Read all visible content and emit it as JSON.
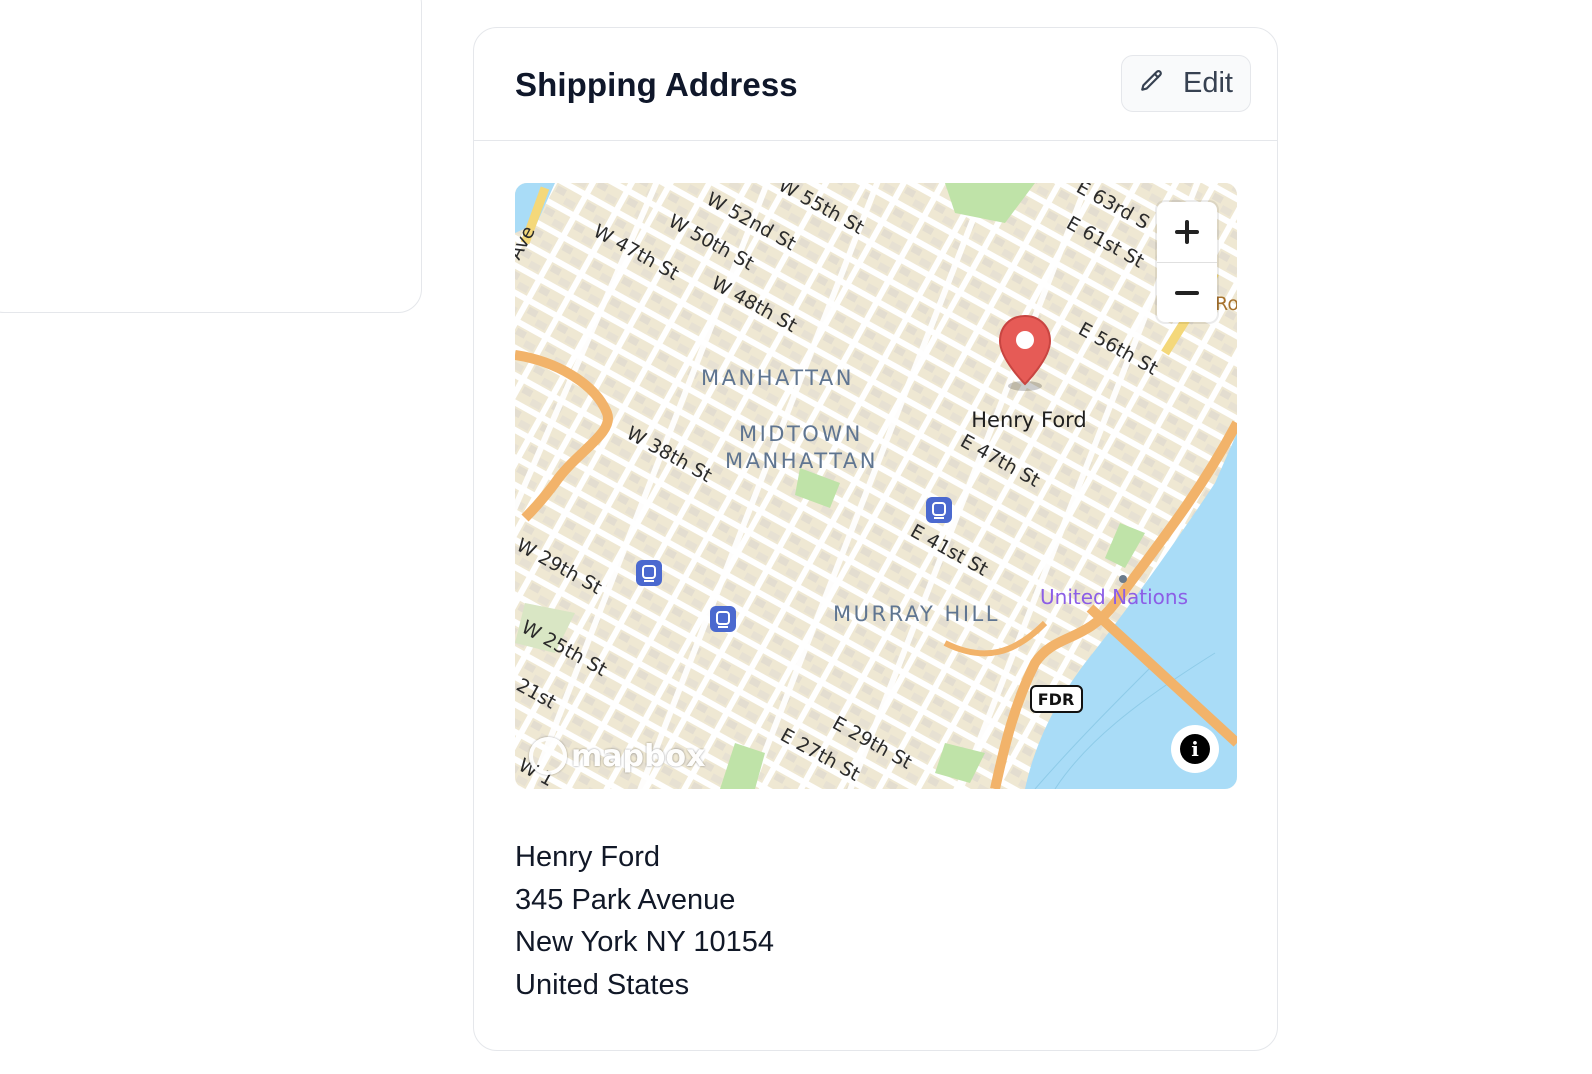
{
  "card": {
    "title": "Shipping Address",
    "edit_label": "Edit"
  },
  "map": {
    "provider_logo": "mapbox",
    "marker_label": "Henry Ford",
    "neighborhoods": [
      "MANHATTAN",
      "MIDTOWN",
      "MANHATTAN",
      "MURRAY HILL"
    ],
    "poi": "United Nations",
    "highway_shield": "FDR",
    "streets": [
      "W 55th St",
      "W 52nd St",
      "W 50th St",
      "W 47th St",
      "W 48th St",
      "W 38th St",
      "W 29th St",
      "W 25th St",
      "E 63rd S",
      "E 61st St",
      "E 56th St",
      "E 47th St",
      "E 41st St",
      "E 29th St",
      "E 27th St",
      "Ave",
      "Ro",
      "W 1",
      "21st"
    ],
    "zoom_in_symbol": "+",
    "zoom_out_symbol": "−",
    "info_symbol": "i",
    "icons": [
      "plus-icon",
      "minus-icon",
      "info-icon",
      "map-pin-icon",
      "subway-icon"
    ]
  },
  "address": {
    "name": "Henry Ford",
    "street": "345 Park Avenue",
    "city_line": "New York NY 10154",
    "country": "United States"
  },
  "colors": {
    "water": "#a9dcf7",
    "land": "#f1ecdc",
    "roads": "#ffffff",
    "highway": "#f2b36a",
    "marker": "#e65b56",
    "label": "#5f7591",
    "poi": "#8c5ee6",
    "subway": "#4b69cf"
  }
}
